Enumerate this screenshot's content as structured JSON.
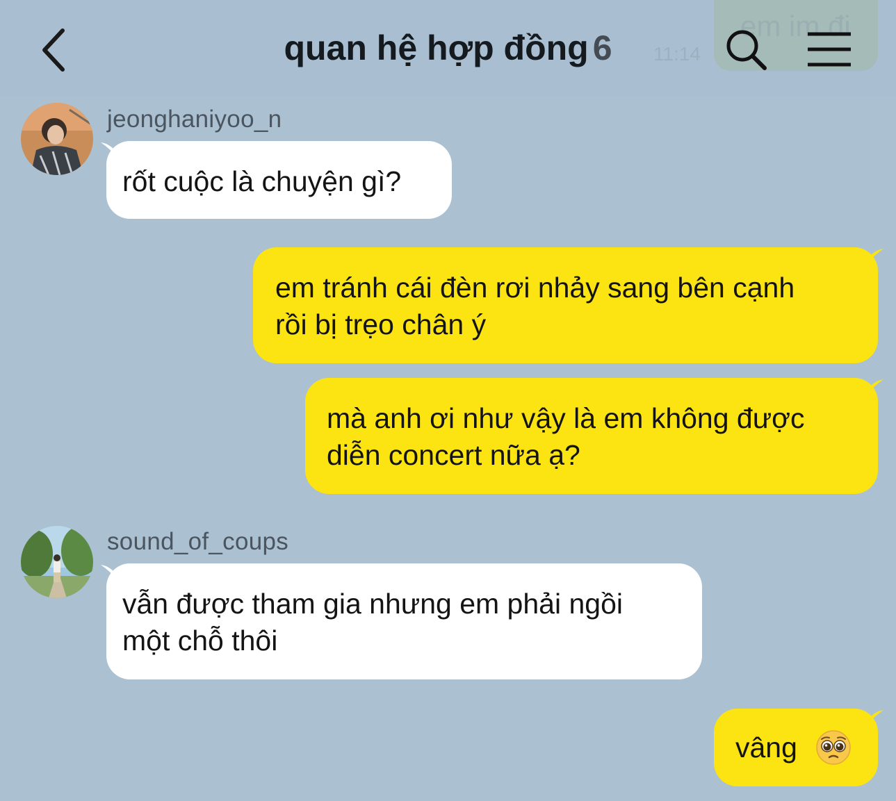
{
  "header": {
    "title": "quan hệ hợp đồng",
    "member_count": "6",
    "back_icon": "chevron-left-icon",
    "search_icon": "search-icon",
    "menu_icon": "menu-icon"
  },
  "ghost": {
    "text": "em im đi",
    "time": "11:14"
  },
  "colors": {
    "background": "#abc1d2",
    "incoming_bubble": "#ffffff",
    "outgoing_bubble": "#fce312"
  },
  "messages": [
    {
      "direction": "in",
      "sender": "jeonghaniyoo_n",
      "text": "rốt cuộc là chuyện gì?"
    },
    {
      "direction": "out",
      "text": "em tránh cái đèn rơi nhảy sang bên cạnh\nrồi bị trẹo chân ý"
    },
    {
      "direction": "out",
      "text": "mà anh ơi như vậy là em không được\ndiễn concert nữa ạ?"
    },
    {
      "direction": "in",
      "sender": "sound_of_coups",
      "text": "vẫn được tham gia nhưng em phải ngồi\nmột chỗ thôi"
    },
    {
      "direction": "out",
      "text": "vâng",
      "emoji": "pleading-face-emoji"
    }
  ]
}
